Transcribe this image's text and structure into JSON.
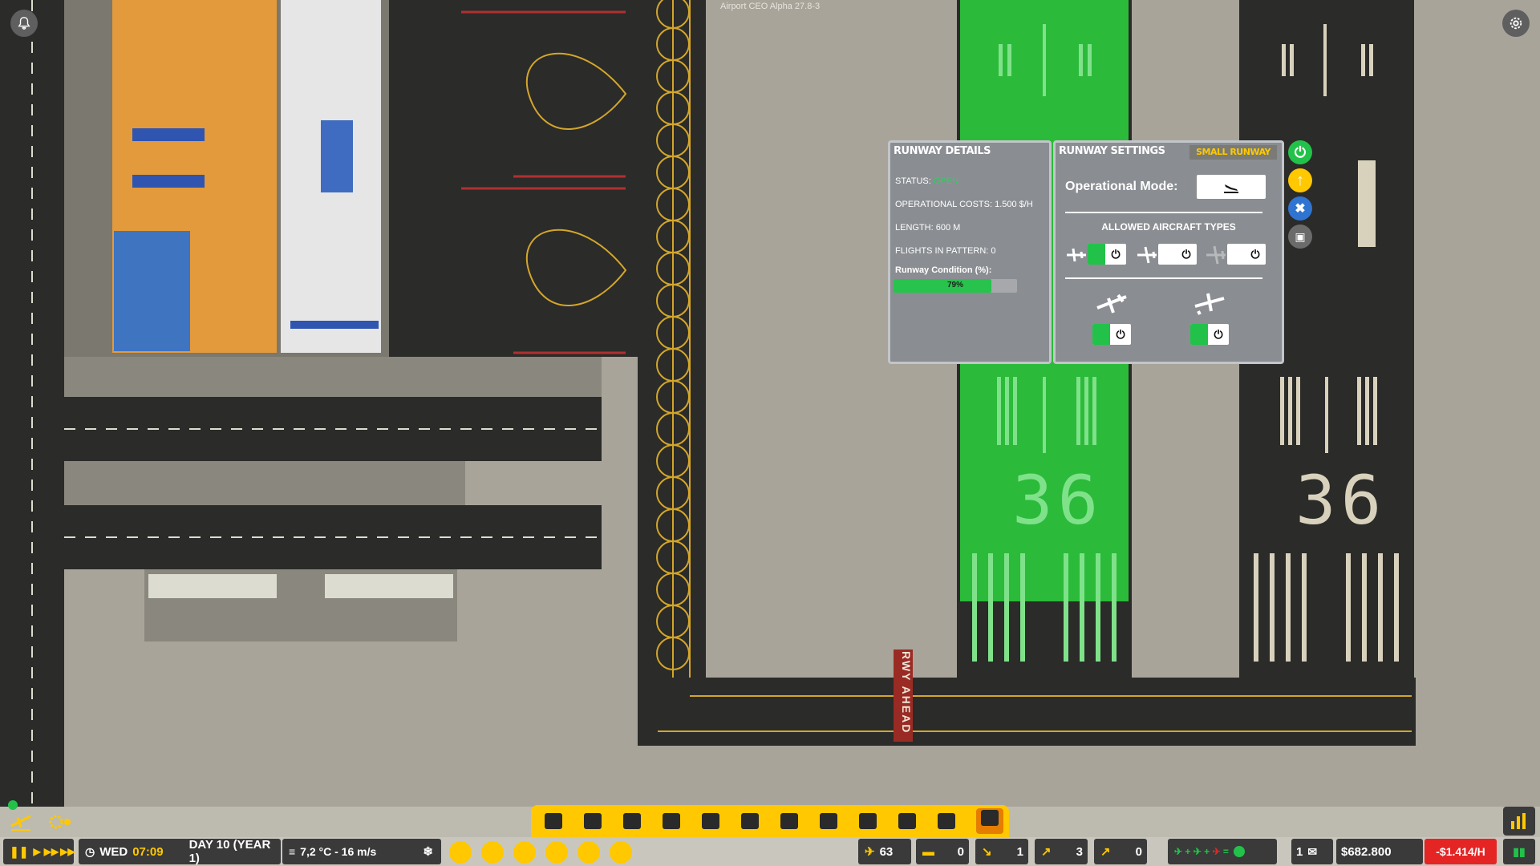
{
  "app": {
    "version": "Airport CEO Alpha 27.8-3"
  },
  "icons": {
    "notification": "bell-icon",
    "settings": "gear-icon",
    "statistics": "bar-chart-icon"
  },
  "runway_details": {
    "title": "RUNWAY DETAILS",
    "status_label": "STATUS:",
    "status_value": "OPEN",
    "operational_costs": "OPERATIONAL COSTS: 1.500 $/H",
    "length": "LENGTH: 600 M",
    "flights_in_pattern": "FLIGHTS IN PATTERN: 0",
    "condition_label": "Runway Condition (%):",
    "condition_value": 0.79,
    "condition_text": "79%"
  },
  "runway_settings": {
    "title": "RUNWAY SETTINGS",
    "size_badge": "SMALL RUNWAY",
    "operational_mode_label": "Operational Mode:",
    "operational_mode_icon": "landing-icon",
    "allowed_types_heading": "ALLOWED AIRCRAFT TYPES",
    "aircraft_types": [
      {
        "icon": "small-prop-plane-icon",
        "enabled": true
      },
      {
        "icon": "medium-jet-icon",
        "enabled": false
      },
      {
        "icon": "large-jet-icon",
        "enabled": false
      }
    ],
    "direction_toggles": [
      {
        "icon": "departure-icon",
        "enabled": true
      },
      {
        "icon": "arrival-icon",
        "enabled": true
      }
    ]
  },
  "side_actions": [
    {
      "icon": "power-icon",
      "color": "#22c24a"
    },
    {
      "icon": "arrow-up-icon",
      "color": "#ffc800"
    },
    {
      "icon": "wrench-icon",
      "color": "#2f74d0"
    },
    {
      "icon": "bulldozer-icon",
      "color": "#6b6b6b"
    }
  ],
  "map_labels": {
    "rwy_ahead": "RWY AHEAD",
    "runway_number_1": "36",
    "runway_number_2": "36"
  },
  "build_menu": [
    "control-tower-icon",
    "airplane-icon",
    "bus-icon",
    "suitcase-icon",
    "person-icon",
    "family-icon",
    "security-icon",
    "toilet-icon",
    "bulldozer-icon",
    "conveyor-icon",
    "food-icon",
    "terrain-icon"
  ],
  "bottom_bar": {
    "day_of_week": "WED",
    "time": "07:09",
    "day": "DAY 10 (YEAR 1)",
    "weather": "7,2 °C - 16 m/s",
    "flights_count": "63",
    "stat_2": "0",
    "stat_3": "1",
    "stat_4": "3",
    "stat_5": "0",
    "messages": "1",
    "money": "$682.800",
    "income_rate": "-$1.414/H"
  },
  "colors": {
    "runway_green": "#2cba3a",
    "accent_yellow": "#ffc800",
    "status_open": "#25d55a",
    "negative": "#e52424"
  }
}
